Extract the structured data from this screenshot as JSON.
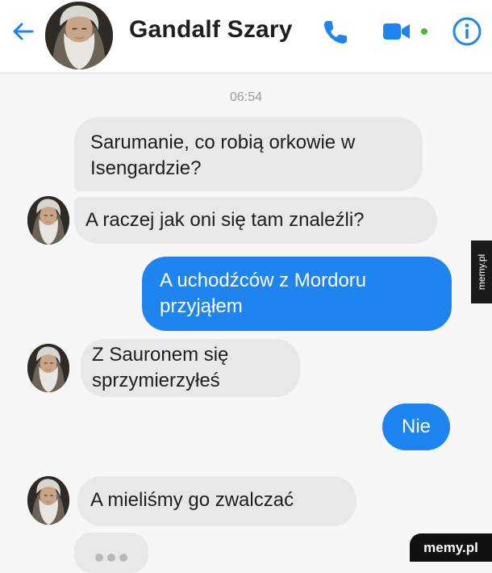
{
  "header": {
    "title": "Gandalf Szary",
    "icons": [
      "back-arrow-icon",
      "phone-icon",
      "video-camera-icon",
      "info-icon"
    ],
    "accent_color": "#1e84f0",
    "online_dot_color": "#44bd32"
  },
  "timestamp": "06:54",
  "messages": [
    {
      "side": "in",
      "lines": [
        "Sarumanie, co robią orkowie w",
        "Isengardzie?"
      ]
    },
    {
      "side": "in",
      "lines": [
        "A raczej jak oni się tam znaleźli?"
      ]
    },
    {
      "side": "out",
      "lines": [
        "A uchodźców z Mordoru",
        "przyjąłem"
      ]
    },
    {
      "side": "in",
      "lines": [
        "Z Sauronem się",
        "sprzymierzyłeś"
      ]
    },
    {
      "side": "out",
      "lines": [
        "Nie"
      ]
    },
    {
      "side": "in",
      "lines": [
        "A mieliśmy go zwalczać"
      ]
    }
  ],
  "watermarks": {
    "side": "memy.pl",
    "corner": "memy.pl"
  }
}
